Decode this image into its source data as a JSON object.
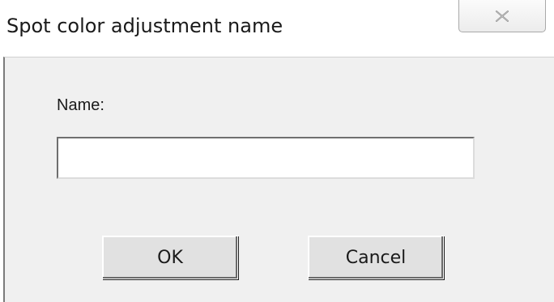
{
  "window": {
    "title": "Spot color adjustment name",
    "close_icon": "close-icon"
  },
  "form": {
    "name_label": "Name:",
    "name_value": "",
    "name_placeholder": ""
  },
  "buttons": {
    "ok_label": "OK",
    "cancel_label": "Cancel"
  },
  "colors": {
    "client_background": "#f0f0f0",
    "button_face": "#e1e1e1",
    "input_background": "#ffffff"
  }
}
